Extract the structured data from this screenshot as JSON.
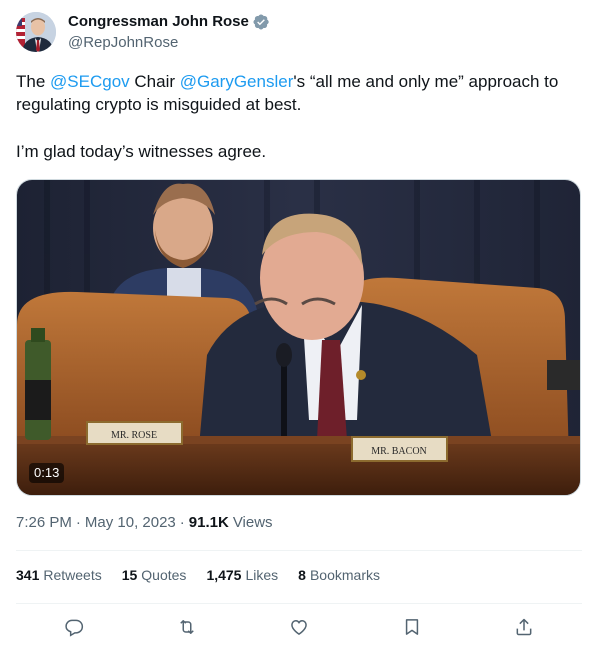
{
  "author": {
    "display_name": "Congressman John Rose",
    "handle": "@RepJohnRose",
    "verified_icon": "verified-badge-icon"
  },
  "tweet": {
    "line1": {
      "p1": "The ",
      "m1": "@SECgov",
      "p2": " Chair ",
      "m2": "@GaryGensler",
      "p3": "'s “all me and only me” approach to regulating crypto is misguided at best."
    },
    "line2": "I’m glad today’s witnesses agree."
  },
  "media": {
    "duration": "0:13",
    "nameplates": {
      "left": "MR. ROSE",
      "right": "MR. BACON"
    }
  },
  "meta": {
    "time": "7:26 PM",
    "separator": "·",
    "date": "May 10, 2023",
    "views_count": "91.1K",
    "views_label": "Views"
  },
  "stats": {
    "retweets": {
      "count": "341",
      "label": "Retweets"
    },
    "quotes": {
      "count": "15",
      "label": "Quotes"
    },
    "likes": {
      "count": "1,475",
      "label": "Likes"
    },
    "bookmarks": {
      "count": "8",
      "label": "Bookmarks"
    }
  },
  "actions": [
    "reply-icon",
    "retweet-icon",
    "like-icon",
    "bookmark-icon",
    "share-icon"
  ],
  "colors": {
    "accent": "#1d9bf0",
    "secondary_text": "#536471",
    "primary_text": "#0f1419"
  }
}
